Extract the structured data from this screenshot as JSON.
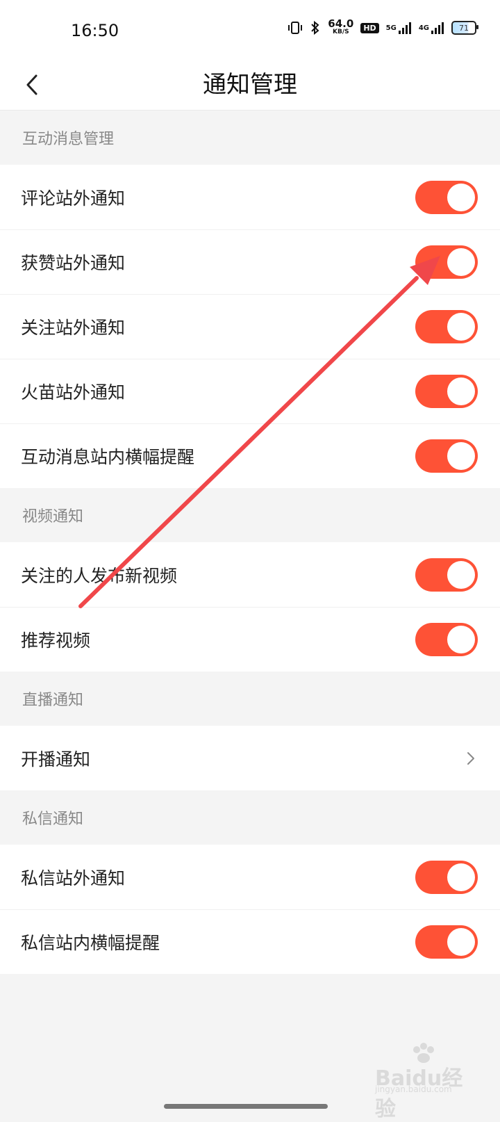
{
  "status": {
    "time": "16:50",
    "speed_value": "64.0",
    "speed_unit": "KB/S",
    "hd_label": "HD",
    "net1": "5G",
    "net2": "4G",
    "battery": "71"
  },
  "header": {
    "title": "通知管理"
  },
  "sections": [
    {
      "title": "互动消息管理",
      "items": [
        {
          "label": "评论站外通知",
          "on": true
        },
        {
          "label": "获赞站外通知",
          "on": true
        },
        {
          "label": "关注站外通知",
          "on": true
        },
        {
          "label": "火苗站外通知",
          "on": true
        },
        {
          "label": "互动消息站内横幅提醒",
          "on": true
        }
      ]
    },
    {
      "title": "视频通知",
      "items": [
        {
          "label": "关注的人发布新视频",
          "on": true
        },
        {
          "label": "推荐视频",
          "on": true
        }
      ]
    },
    {
      "title": "直播通知",
      "items": [
        {
          "label": "开播通知",
          "type": "link"
        }
      ]
    },
    {
      "title": "私信通知",
      "items": [
        {
          "label": "私信站外通知",
          "on": true
        },
        {
          "label": "私信站内横幅提醒",
          "on": true
        }
      ]
    }
  ],
  "watermark": {
    "brand": "Baidu经验",
    "sub": "jingyan.baidu.com"
  },
  "colors": {
    "accent": "#fe5236",
    "annotation": "#f0474a"
  }
}
